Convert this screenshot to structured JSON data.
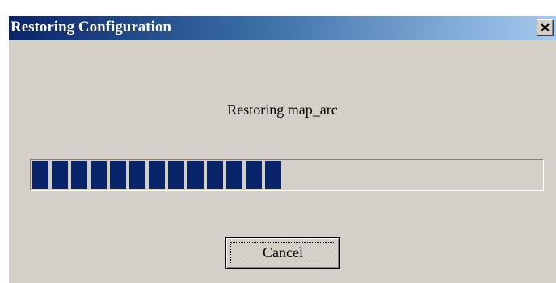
{
  "window": {
    "title": "Restoring Configuration",
    "close_icon": "close-x-icon"
  },
  "dialog": {
    "message": "Restoring map_arc"
  },
  "progress": {
    "fraction": 0.49
  },
  "buttons": {
    "cancel_label": "Cancel"
  },
  "colors": {
    "title_gradient_start": "#0a246a",
    "title_gradient_end": "#a6caf0",
    "progress_block": "#0a246a",
    "dialog_face": "#d4d0c8"
  }
}
